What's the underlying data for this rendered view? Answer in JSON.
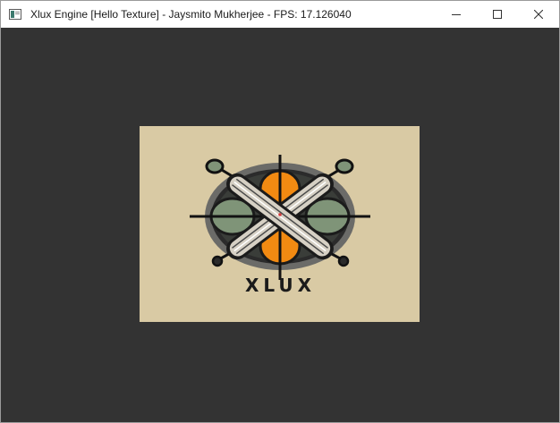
{
  "window": {
    "title": "Xlux Engine [Hello Texture] - Jaysmito Mukherjee - FPS: 17.126040",
    "controls": {
      "minimize_icon": "minimize-icon",
      "maximize_icon": "maximize-icon",
      "close_icon": "close-icon"
    }
  },
  "texture": {
    "logo_text": "XLUX",
    "colors": {
      "background": "#d9caa4",
      "client": "#333333",
      "orange": "#f28a12",
      "green": "#7f9478",
      "dark": "#1b1b1b"
    }
  }
}
